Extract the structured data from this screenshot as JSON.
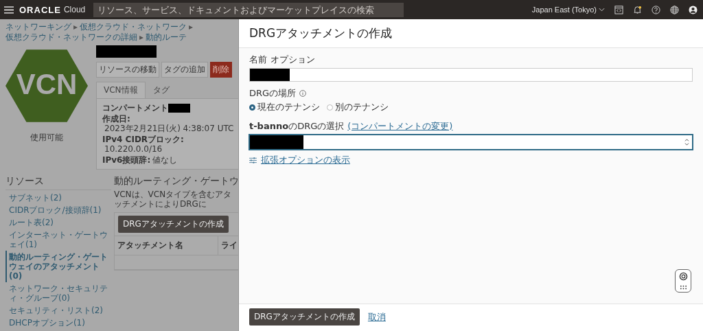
{
  "top_bar": {
    "brand": "ORACLE",
    "brand_suffix": "Cloud",
    "search": {
      "placeholder": "リソース、サービス、ドキュメントおよびマーケットプレイスの検索"
    },
    "region": "Japan East (Tokyo)"
  },
  "breadcrumb": [
    {
      "label": "ネットワーキング",
      "separator": "▸"
    },
    {
      "label": "仮想クラウド・ネットワーク",
      "separator": "▸"
    },
    {
      "label": "仮想クラウド・ネットワークの詳細",
      "separator": "▸"
    },
    {
      "label": "動的ルーテ"
    }
  ],
  "vcn": {
    "label": "VCN",
    "status": "使用可能"
  },
  "actions": [
    {
      "label": "リソースの移動",
      "kind": "default"
    },
    {
      "label": "タグの追加",
      "kind": "default"
    },
    {
      "label": "削除",
      "kind": "danger"
    }
  ],
  "tabs": [
    {
      "label": "VCN情報",
      "selected": true
    },
    {
      "label": "タグ",
      "selected": false
    }
  ],
  "info": [
    {
      "label": "コンパートメント",
      "kind": "redacted"
    },
    {
      "label": "作成日:",
      "value": "2023年2月21日(火) 4:38:07 UTC",
      "kind": "text"
    },
    {
      "label": "IPv4 CIDRブロック:",
      "value": "10.220.0.0/16",
      "kind": "text"
    },
    {
      "label": "IPv6接頭辞:",
      "value": "値なし",
      "kind": "text"
    }
  ],
  "resources": {
    "title": "リソース",
    "items": [
      {
        "label": "サブネット(2)",
        "selected": false
      },
      {
        "label": "CIDRブロック/接頭辞(1)",
        "selected": false
      },
      {
        "label": "ルート表(2)",
        "selected": false
      },
      {
        "label": "インターネット・ゲートウェイ(1)",
        "selected": false
      },
      {
        "label": "動的ルーティング・ゲートウェイのアタッチメント (0)",
        "selected": true
      },
      {
        "label": "ネットワーク・セキュリティ・グループ(0)",
        "selected": false
      },
      {
        "label": "セキュリティ・リスト(2)",
        "selected": false
      },
      {
        "label": "DHCPオプション(1)",
        "selected": false
      }
    ]
  },
  "section": {
    "title": "動的ルーティング・ゲートウ",
    "description": "VCNは、VCNタイプを含むアタッチメントによりDRGに",
    "create_button": "DRGアタッチメントの作成",
    "columns": [
      "アタッチメント名",
      "ライ"
    ]
  },
  "panel": {
    "title": "DRGアタッチメントの作成",
    "name_field": {
      "label": "名前",
      "optional": "オプション"
    },
    "drg_location": {
      "label": "DRGの場所",
      "options": [
        {
          "label": "現在のテナンシ",
          "selected": true
        },
        {
          "label": "別のテナンシ",
          "selected": false
        }
      ]
    },
    "drg_select": {
      "label": "**t-banno**のDRGの選択",
      "link": "(コンパートメントの変更)"
    },
    "advanced_link": "拡張オプションの表示",
    "submit": "DRGアタッチメントの作成",
    "cancel": "取消"
  }
}
